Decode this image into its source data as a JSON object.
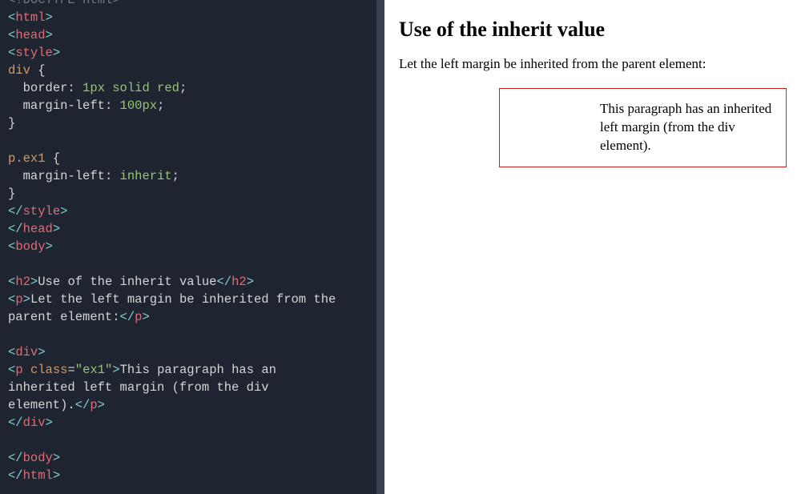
{
  "code": {
    "lines": [
      [
        {
          "c": "tk-doctype",
          "t": "<!DOCTYPE html>"
        }
      ],
      [
        {
          "c": "tk-br",
          "t": "<"
        },
        {
          "c": "tk-tag",
          "t": "html"
        },
        {
          "c": "tk-br",
          "t": ">"
        }
      ],
      [
        {
          "c": "tk-br",
          "t": "<"
        },
        {
          "c": "tk-tag",
          "t": "head"
        },
        {
          "c": "tk-br",
          "t": ">"
        }
      ],
      [
        {
          "c": "tk-br",
          "t": "<"
        },
        {
          "c": "tk-tag",
          "t": "style"
        },
        {
          "c": "tk-br",
          "t": ">"
        }
      ],
      [
        {
          "c": "tk-sel",
          "t": "div"
        },
        {
          "c": "tk-txt",
          "t": " "
        },
        {
          "c": "tk-punc",
          "t": "{"
        }
      ],
      [
        {
          "c": "tk-txt",
          "t": "  "
        },
        {
          "c": "tk-prop",
          "t": "border"
        },
        {
          "c": "tk-punc",
          "t": ": "
        },
        {
          "c": "tk-val",
          "t": "1px solid red"
        },
        {
          "c": "tk-punc",
          "t": ";"
        }
      ],
      [
        {
          "c": "tk-txt",
          "t": "  "
        },
        {
          "c": "tk-prop",
          "t": "margin-left"
        },
        {
          "c": "tk-punc",
          "t": ": "
        },
        {
          "c": "tk-val",
          "t": "100px"
        },
        {
          "c": "tk-punc",
          "t": ";"
        }
      ],
      [
        {
          "c": "tk-punc",
          "t": "}"
        }
      ],
      [
        {
          "c": "tk-txt",
          "t": " "
        }
      ],
      [
        {
          "c": "tk-sel",
          "t": "p.ex1"
        },
        {
          "c": "tk-txt",
          "t": " "
        },
        {
          "c": "tk-punc",
          "t": "{"
        }
      ],
      [
        {
          "c": "tk-txt",
          "t": "  "
        },
        {
          "c": "tk-prop",
          "t": "margin-left"
        },
        {
          "c": "tk-punc",
          "t": ": "
        },
        {
          "c": "tk-val",
          "t": "inherit"
        },
        {
          "c": "tk-punc",
          "t": ";"
        }
      ],
      [
        {
          "c": "tk-punc",
          "t": "}"
        }
      ],
      [
        {
          "c": "tk-br",
          "t": "</"
        },
        {
          "c": "tk-tag",
          "t": "style"
        },
        {
          "c": "tk-br",
          "t": ">"
        }
      ],
      [
        {
          "c": "tk-br",
          "t": "</"
        },
        {
          "c": "tk-tag",
          "t": "head"
        },
        {
          "c": "tk-br",
          "t": ">"
        }
      ],
      [
        {
          "c": "tk-br",
          "t": "<"
        },
        {
          "c": "tk-tag",
          "t": "body"
        },
        {
          "c": "tk-br",
          "t": ">"
        }
      ],
      [
        {
          "c": "tk-txt",
          "t": " "
        }
      ],
      [
        {
          "c": "tk-br",
          "t": "<"
        },
        {
          "c": "tk-tag",
          "t": "h2"
        },
        {
          "c": "tk-br",
          "t": ">"
        },
        {
          "c": "tk-txt",
          "t": "Use of the inherit value"
        },
        {
          "c": "tk-br",
          "t": "</"
        },
        {
          "c": "tk-tag",
          "t": "h2"
        },
        {
          "c": "tk-br",
          "t": ">"
        }
      ],
      [
        {
          "c": "tk-br",
          "t": "<"
        },
        {
          "c": "tk-tag",
          "t": "p"
        },
        {
          "c": "tk-br",
          "t": ">"
        },
        {
          "c": "tk-txt",
          "t": "Let the left margin be inherited from the "
        }
      ],
      [
        {
          "c": "tk-txt",
          "t": "parent element:"
        },
        {
          "c": "tk-br",
          "t": "</"
        },
        {
          "c": "tk-tag",
          "t": "p"
        },
        {
          "c": "tk-br",
          "t": ">"
        }
      ],
      [
        {
          "c": "tk-txt",
          "t": " "
        }
      ],
      [
        {
          "c": "tk-br",
          "t": "<"
        },
        {
          "c": "tk-tag",
          "t": "div"
        },
        {
          "c": "tk-br",
          "t": ">"
        }
      ],
      [
        {
          "c": "tk-br",
          "t": "<"
        },
        {
          "c": "tk-tag",
          "t": "p"
        },
        {
          "c": "tk-txt",
          "t": " "
        },
        {
          "c": "tk-attr",
          "t": "class"
        },
        {
          "c": "tk-punc",
          "t": "="
        },
        {
          "c": "tk-str",
          "t": "\"ex1\""
        },
        {
          "c": "tk-br",
          "t": ">"
        },
        {
          "c": "tk-txt",
          "t": "This paragraph has an "
        }
      ],
      [
        {
          "c": "tk-txt",
          "t": "inherited left margin (from the div "
        }
      ],
      [
        {
          "c": "tk-txt",
          "t": "element)."
        },
        {
          "c": "tk-br",
          "t": "</"
        },
        {
          "c": "tk-tag",
          "t": "p"
        },
        {
          "c": "tk-br",
          "t": ">"
        }
      ],
      [
        {
          "c": "tk-br",
          "t": "</"
        },
        {
          "c": "tk-tag",
          "t": "div"
        },
        {
          "c": "tk-br",
          "t": ">"
        }
      ],
      [
        {
          "c": "tk-txt",
          "t": " "
        }
      ],
      [
        {
          "c": "tk-br",
          "t": "</"
        },
        {
          "c": "tk-tag",
          "t": "body"
        },
        {
          "c": "tk-br",
          "t": ">"
        }
      ],
      [
        {
          "c": "tk-br",
          "t": "</"
        },
        {
          "c": "tk-tag",
          "t": "html"
        },
        {
          "c": "tk-br",
          "t": ">"
        }
      ]
    ]
  },
  "output": {
    "heading": "Use of the inherit value",
    "intro": "Let the left margin be inherited from the parent element:",
    "boxText": "This paragraph has an inherited left margin (from the div element)."
  }
}
